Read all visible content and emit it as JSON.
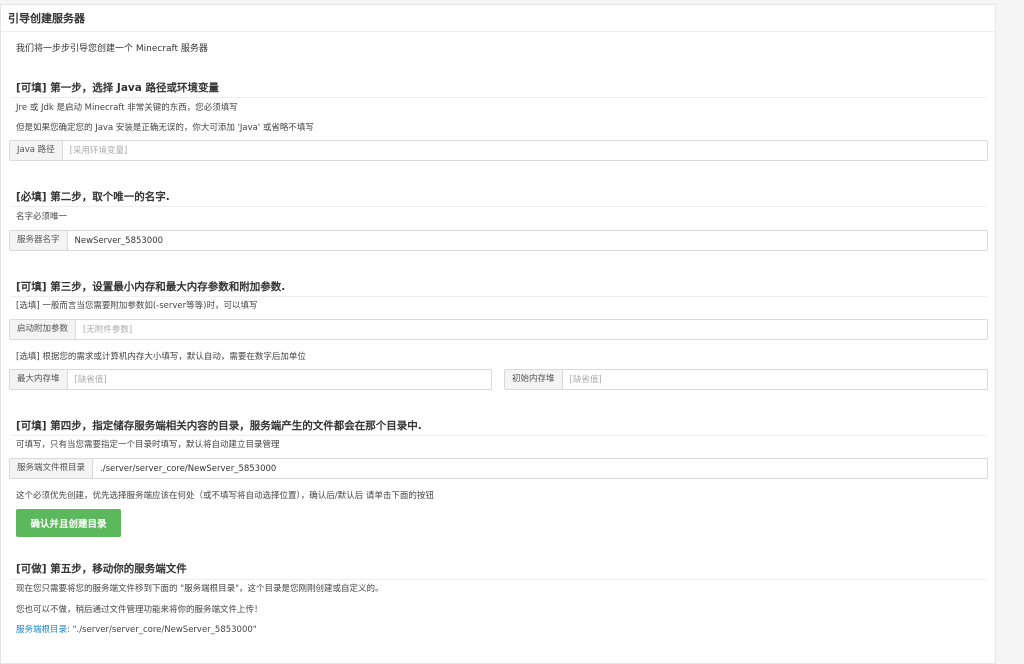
{
  "header": {
    "title": "引导创建服务器"
  },
  "intro": "我们将一步步引导您创建一个 Minecraft 服务器",
  "step1": {
    "title": "[可填] 第一步，选择 Java 路径或环境变量",
    "desc1": "Jre 或 Jdk 是启动 Minecraft 非常关键的东西，您必须填写",
    "desc2": "但是如果您确定您的 Java 安装是正确无误的，你大可添加 'Java' 或省略不填写",
    "java_label": "Java 路径",
    "java_placeholder": "[采用环境变量]",
    "java_value": ""
  },
  "step2": {
    "title": "[必填] 第二步，取个唯一的名字.",
    "desc": "名字必须唯一",
    "name_label": "服务器名字",
    "name_value": "NewServer_5853000"
  },
  "step3": {
    "title": "[可填] 第三步，设置最小内存和最大内存参数和附加参数.",
    "desc1": "[选填] 一般而言当您需要附加参数如(-server等等)时，可以填写",
    "args_label": "启动附加参数",
    "args_placeholder": "[无附件参数]",
    "args_value": "",
    "desc2": "[选填] 根据您的需求或计算机内存大小填写，默认自动，需要在数字后加单位",
    "max_mem_label": "最大内存堆",
    "max_mem_placeholder": "[缺省值]",
    "max_mem_value": "",
    "min_mem_label": "初始内存堆",
    "min_mem_placeholder": "[缺省值]",
    "min_mem_value": ""
  },
  "step4": {
    "title": "[可填] 第四步，指定储存服务端相关内容的目录，服务端产生的文件都会在那个目录中.",
    "desc": "可填写，只有当您需要指定一个目录时填写，默认将自动建立目录管理",
    "dir_label": "服务端文件根目录",
    "dir_value": "./server/server_core/NewServer_5853000",
    "note": "这个必须优先创建，优先选择服务端应该在何处（或不填写将自动选择位置），确认后/默认后 请单击下面的按钮",
    "confirm_button": "确认并且创建目录"
  },
  "step5": {
    "title": "[可做] 第五步，移动你的服务端文件",
    "desc1": "现在您只需要将您的服务端文件移到下面的 \"服务端根目录\"，这个目录是您刚刚创建或自定义的。",
    "desc2": "您也可以不做，稍后通过文件管理功能来将你的服务端文件上传！",
    "root_label": "服务端根目录:",
    "root_path": " \"./server/server_core/NewServer_5853000\""
  }
}
